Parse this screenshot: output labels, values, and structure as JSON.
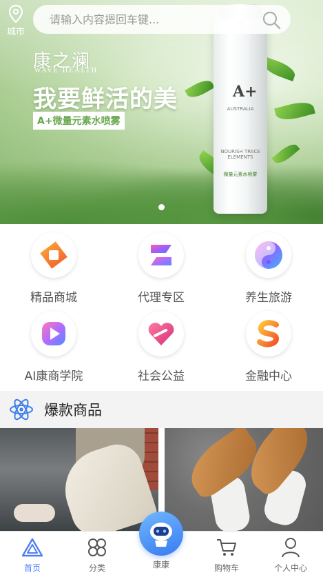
{
  "header": {
    "city_label": "城市",
    "search_placeholder": "请输入内容摁回车键..."
  },
  "banner": {
    "brand": "康之澜",
    "brand_sub": "WAVE·HEALTH",
    "headline": "我要鲜活的美",
    "tagline": "A+微量元素水喷雾",
    "bottle_mark": "A+",
    "bottle_text_1": "AUSTRALIA",
    "bottle_text_2": "NOURISH TRACE ELEMENTS",
    "bottle_text_3": "微量元素水喷雾",
    "slide_count": 1,
    "active_slide": 1
  },
  "categories": [
    {
      "label": "精品商城",
      "icon": "mall-icon"
    },
    {
      "label": "代理专区",
      "icon": "agent-icon"
    },
    {
      "label": "养生旅游",
      "icon": "wellness-travel-icon"
    },
    {
      "label": "AI康商学院",
      "icon": "academy-icon"
    },
    {
      "label": "社会公益",
      "icon": "charity-icon"
    },
    {
      "label": "金融中心",
      "icon": "finance-icon"
    }
  ],
  "section": {
    "title": "爆款商品",
    "icon": "atom-icon"
  },
  "tabs": [
    {
      "label": "首页",
      "icon": "home-icon",
      "active": true
    },
    {
      "label": "分类",
      "icon": "category-icon",
      "active": false
    },
    {
      "label": "康康",
      "icon": "robot-icon",
      "active": false
    },
    {
      "label": "购物车",
      "icon": "cart-icon",
      "active": false
    },
    {
      "label": "个人中心",
      "icon": "user-icon",
      "active": false
    }
  ],
  "colors": {
    "accent": "#4f7df3",
    "section_bg": "#f3f3f3",
    "banner_green": "#8fbc74"
  }
}
